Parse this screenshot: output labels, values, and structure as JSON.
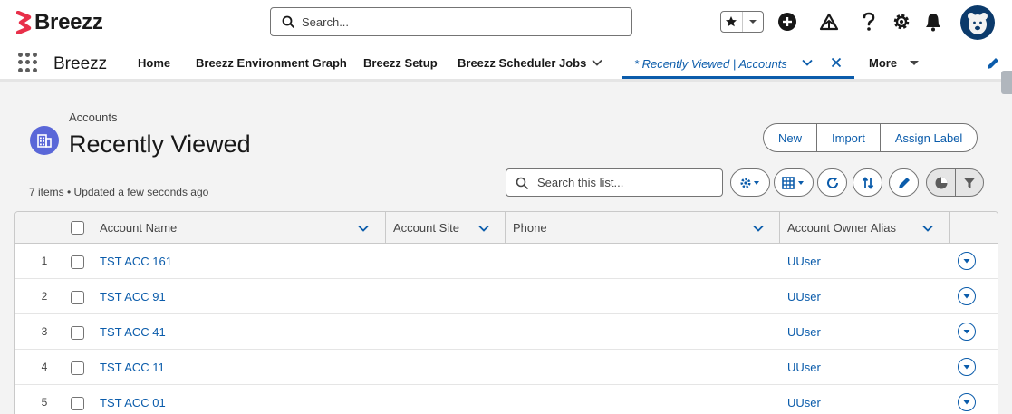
{
  "brand": {
    "name": "Breezz",
    "accent": "#e8304a"
  },
  "search": {
    "placeholder": "Search..."
  },
  "header_icons": [
    "star-icon",
    "chevron-down-icon",
    "add-icon",
    "trailhead-icon",
    "help-icon",
    "gear-icon",
    "bell-icon",
    "avatar"
  ],
  "nav": {
    "app_name": "Breezz",
    "items": [
      "Home",
      "Breezz Environment Graph",
      "Breezz Setup",
      "Breezz Scheduler Jobs"
    ],
    "active_tab": "* Recently Viewed | Accounts",
    "more": "More"
  },
  "page": {
    "breadcrumb": "Accounts",
    "title": "Recently Viewed",
    "meta": "7 items • Updated a few seconds ago",
    "buttons": {
      "new": "New",
      "import": "Import",
      "assign_label": "Assign Label"
    },
    "list_search_placeholder": "Search this list..."
  },
  "table": {
    "columns": [
      "Account Name",
      "Account Site",
      "Phone",
      "Account Owner Alias"
    ],
    "rows": [
      {
        "num": "1",
        "name": "TST ACC 161",
        "site": "",
        "phone": "",
        "owner": "UUser"
      },
      {
        "num": "2",
        "name": "TST ACC 91",
        "site": "",
        "phone": "",
        "owner": "UUser"
      },
      {
        "num": "3",
        "name": "TST ACC 41",
        "site": "",
        "phone": "",
        "owner": "UUser"
      },
      {
        "num": "4",
        "name": "TST ACC 11",
        "site": "",
        "phone": "",
        "owner": "UUser"
      },
      {
        "num": "5",
        "name": "TST ACC 01",
        "site": "",
        "phone": "",
        "owner": "UUser"
      }
    ]
  },
  "colors": {
    "link": "#0b5cab",
    "object_icon": "#5a67d8",
    "background": "#f3f3f3"
  }
}
